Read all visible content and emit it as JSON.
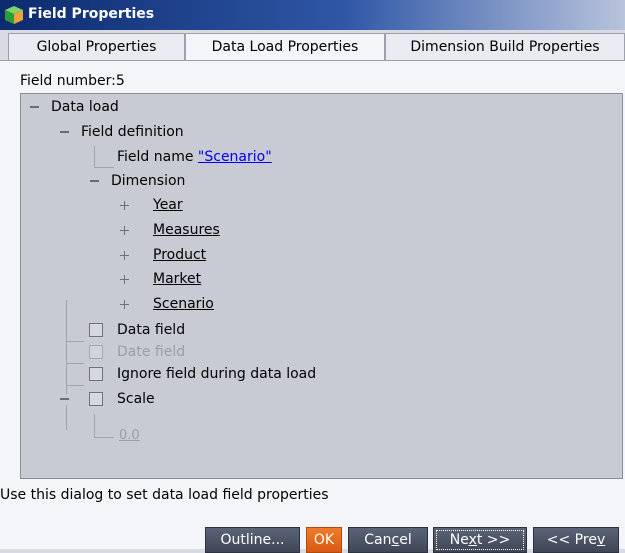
{
  "window": {
    "title": "Field Properties"
  },
  "tabs": [
    {
      "label": "Global Properties"
    },
    {
      "label": "Data Load Properties"
    },
    {
      "label": "Dimension Build Properties"
    }
  ],
  "field_number": "Field number:5",
  "tree": {
    "data_load": "Data load",
    "field_definition": "Field definition",
    "field_name_label": "Field name",
    "field_name_value": "\"Scenario\"",
    "dimension": "Dimension",
    "dimensions": [
      "Year",
      "Measures",
      "Product",
      "Market",
      "Scenario"
    ],
    "data_field": "Data field",
    "date_field": "Date field",
    "ignore_field": "Ignore field during data load",
    "scale": "Scale",
    "scale_value": "0.0"
  },
  "status_text": "Use this dialog to set data load field properties",
  "buttons": {
    "outline": "Outline...",
    "ok": "OK",
    "cancel_pre": "Can",
    "cancel_u": "c",
    "cancel_post": "el",
    "next_pre": "Ne",
    "next_u": "x",
    "next_post": "t >>",
    "prev_pre": "<< Pre",
    "prev_u": "v"
  }
}
